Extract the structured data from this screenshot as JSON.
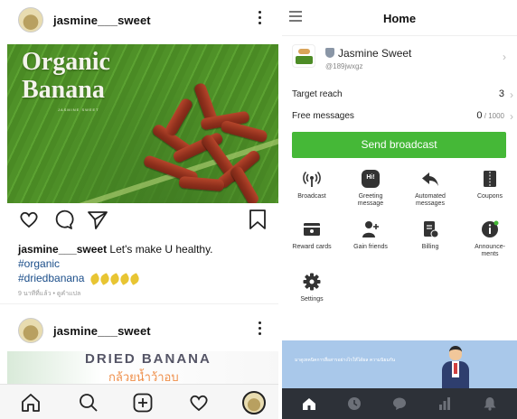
{
  "instagram": {
    "post1": {
      "username": "jasmine___sweet",
      "image_title_line1": "Organic",
      "image_title_line2": "Banana",
      "image_subtitle": "JASMINE SWEET",
      "caption_user": "jasmine___sweet",
      "caption_text": " Let's make U healthy.",
      "hashtag1": "#organic",
      "hashtag2": "#driedbanana",
      "timestamp": "9 นาทีที่แล้ว • ดูคำแปล"
    },
    "post2": {
      "username": "jasmine___sweet",
      "image_title": "DRIED BANANA",
      "image_subtitle": "กล้วยน้ำว้าอบ"
    },
    "nav": [
      "home-icon",
      "search-icon",
      "add-icon",
      "heart-icon",
      "profile-avatar"
    ]
  },
  "line_oa": {
    "header_title": "Home",
    "account": {
      "name": "Jasmine Sweet",
      "id": "@189jwxgz"
    },
    "target_reach": {
      "label": "Target reach",
      "value": "3"
    },
    "free_messages": {
      "label": "Free messages",
      "value": "0",
      "limit": " / 1000"
    },
    "broadcast_button": "Send broadcast",
    "menu": [
      {
        "icon": "broadcast-icon",
        "label": "Broadcast"
      },
      {
        "icon": "greeting-message-icon",
        "label": "Greeting message",
        "icon_text": "Hi!"
      },
      {
        "icon": "automated-messages-icon",
        "label": "Automated messages"
      },
      {
        "icon": "coupons-icon",
        "label": "Coupons"
      },
      {
        "icon": "reward-cards-icon",
        "label": "Reward cards"
      },
      {
        "icon": "gain-friends-icon",
        "label": "Gain friends"
      },
      {
        "icon": "billing-icon",
        "label": "Billing"
      },
      {
        "icon": "announcements-icon",
        "label": "Announce-ments"
      },
      {
        "icon": "settings-icon",
        "label": "Settings"
      }
    ],
    "banner_text": "มาดูเทคนิคการสื่อสารอย่างไรให้ได้ผล ความนิยมกัน",
    "colors": {
      "accent": "#45b837",
      "nav_bg": "#2d3138",
      "banner_bg": "#a9c8ea"
    }
  }
}
